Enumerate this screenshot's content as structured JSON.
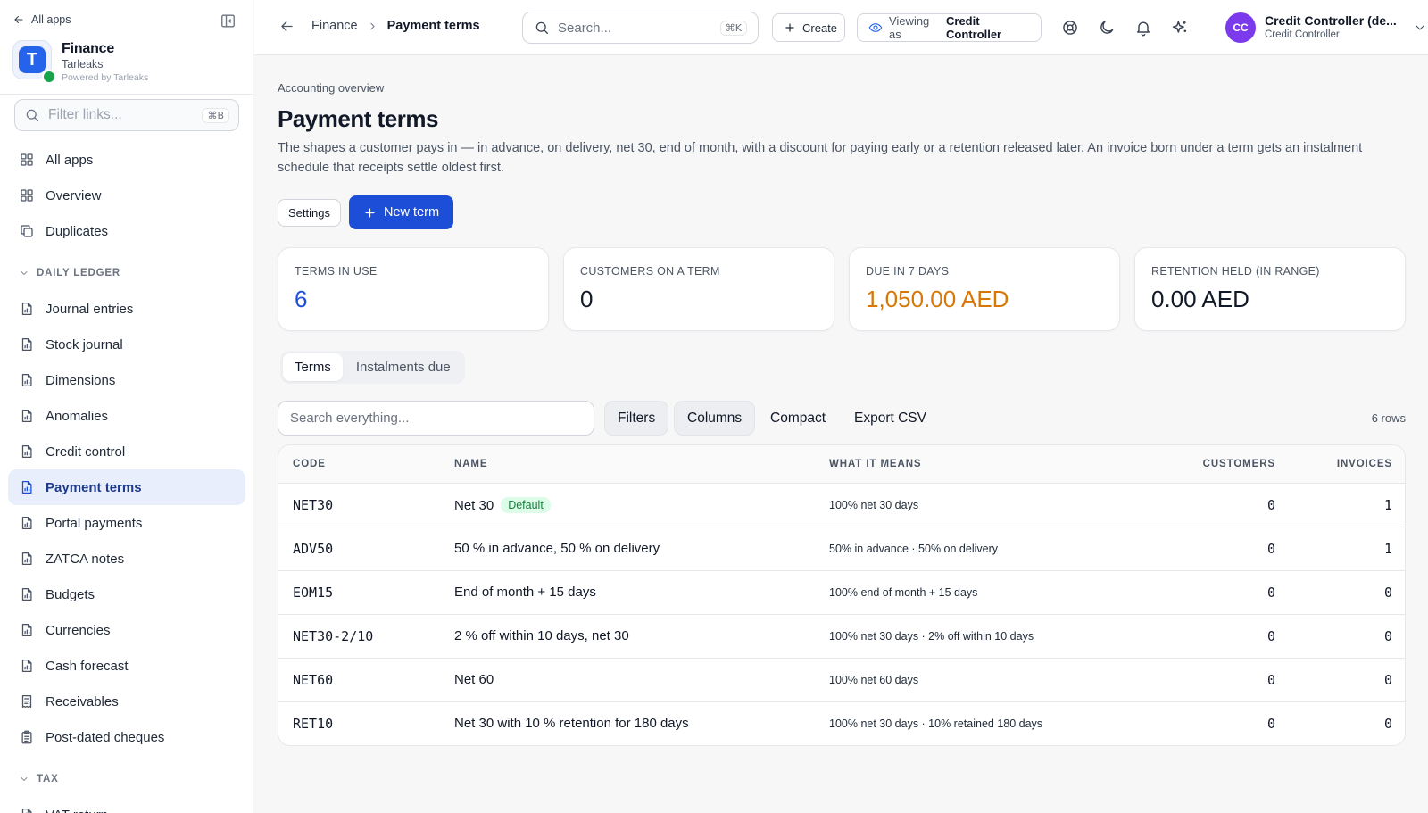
{
  "sidebar": {
    "all_apps": "All apps",
    "brand": {
      "name": "Finance",
      "org": "Tarleaks",
      "powered": "Powered by Tarleaks",
      "logo_letter": "T"
    },
    "filter": {
      "placeholder": "Filter links...",
      "shortcut": "⌘B"
    },
    "items_top": [
      {
        "label": "All apps",
        "icon": "grid-icon"
      },
      {
        "label": "Overview",
        "icon": "grid-icon"
      },
      {
        "label": "Duplicates",
        "icon": "copy-icon"
      }
    ],
    "section_daily": "DAILY LEDGER",
    "items_daily": [
      {
        "label": "Journal entries",
        "icon": "document-icon"
      },
      {
        "label": "Stock journal",
        "icon": "document-icon"
      },
      {
        "label": "Dimensions",
        "icon": "document-icon"
      },
      {
        "label": "Anomalies",
        "icon": "document-icon"
      },
      {
        "label": "Credit control",
        "icon": "document-icon"
      },
      {
        "label": "Payment terms",
        "icon": "document-icon",
        "active": true
      },
      {
        "label": "Portal payments",
        "icon": "document-icon"
      },
      {
        "label": "ZATCA notes",
        "icon": "document-icon"
      },
      {
        "label": "Budgets",
        "icon": "document-icon"
      },
      {
        "label": "Currencies",
        "icon": "document-icon"
      },
      {
        "label": "Cash forecast",
        "icon": "document-icon"
      },
      {
        "label": "Receivables",
        "icon": "receipt-icon"
      },
      {
        "label": "Post-dated cheques",
        "icon": "clipboard-icon"
      }
    ],
    "section_tax": "TAX",
    "items_tax": [
      {
        "label": "VAT return",
        "icon": "dollar-document-icon"
      }
    ]
  },
  "topbar": {
    "breadcrumb": {
      "parent": "Finance",
      "current": "Payment terms"
    },
    "search": {
      "placeholder": "Search...",
      "shortcut": "⌘K"
    },
    "create_label": "Create",
    "viewing_label": "Viewing as",
    "viewing_role": "Credit Controller",
    "user": {
      "initials": "CC",
      "name": "Credit Controller (de...",
      "role": "Credit Controller"
    }
  },
  "page": {
    "eyebrow": "Accounting overview",
    "title": "Payment terms",
    "description": "The shapes a customer pays in — in advance, on delivery, net 30, end of month, with a discount for paying early or a retention released later. An invoice born under a term gets an instalment schedule that receipts settle oldest first.",
    "settings_label": "Settings",
    "new_label": "New term"
  },
  "stats": [
    {
      "label": "TERMS IN USE",
      "value": "6",
      "color": "#1d4ed8"
    },
    {
      "label": "CUSTOMERS ON A TERM",
      "value": "0",
      "color": "#111827"
    },
    {
      "label": "DUE IN 7 DAYS",
      "value": "1,050.00 AED",
      "color": "#d97706"
    },
    {
      "label": "RETENTION HELD (IN RANGE)",
      "value": "0.00 AED",
      "color": "#111827"
    }
  ],
  "tabs": [
    {
      "label": "Terms",
      "active": true
    },
    {
      "label": "Instalments due",
      "active": false
    }
  ],
  "toolbar": {
    "search_placeholder": "Search everything...",
    "filters": "Filters",
    "columns": "Columns",
    "compact": "Compact",
    "export": "Export CSV",
    "rows": "6 rows"
  },
  "table": {
    "headers": {
      "code": "CODE",
      "name": "NAME",
      "means": "WHAT IT MEANS",
      "customers": "CUSTOMERS",
      "invoices": "INVOICES"
    },
    "rows": [
      {
        "code": "NET30",
        "name": "Net 30",
        "badge": "Default",
        "means": "100% net 30 days",
        "customers": "0",
        "invoices": "1"
      },
      {
        "code": "ADV50",
        "name": "50 % in advance, 50 % on delivery",
        "means": "50% in advance · 50% on delivery",
        "customers": "0",
        "invoices": "1"
      },
      {
        "code": "EOM15",
        "name": "End of month + 15 days",
        "means": "100% end of month + 15 days",
        "customers": "0",
        "invoices": "0"
      },
      {
        "code": "NET30-2/10",
        "name": "2 % off within 10 days, net 30",
        "means": "100% net 30 days · 2% off within 10 days",
        "customers": "0",
        "invoices": "0"
      },
      {
        "code": "NET60",
        "name": "Net 60",
        "means": "100% net 60 days",
        "customers": "0",
        "invoices": "0"
      },
      {
        "code": "RET10",
        "name": "Net 30 with 10 % retention for 180 days",
        "means": "100% net 30 days · 10% retained 180 days",
        "customers": "0",
        "invoices": "0"
      }
    ]
  },
  "colors": {
    "accent": "#1d4ed8",
    "active_nav_bg": "#e8eefb",
    "amber": "#d97706",
    "badge_bg": "#dcfce7",
    "badge_text": "#15803d",
    "avatar": "#7c3aed"
  }
}
